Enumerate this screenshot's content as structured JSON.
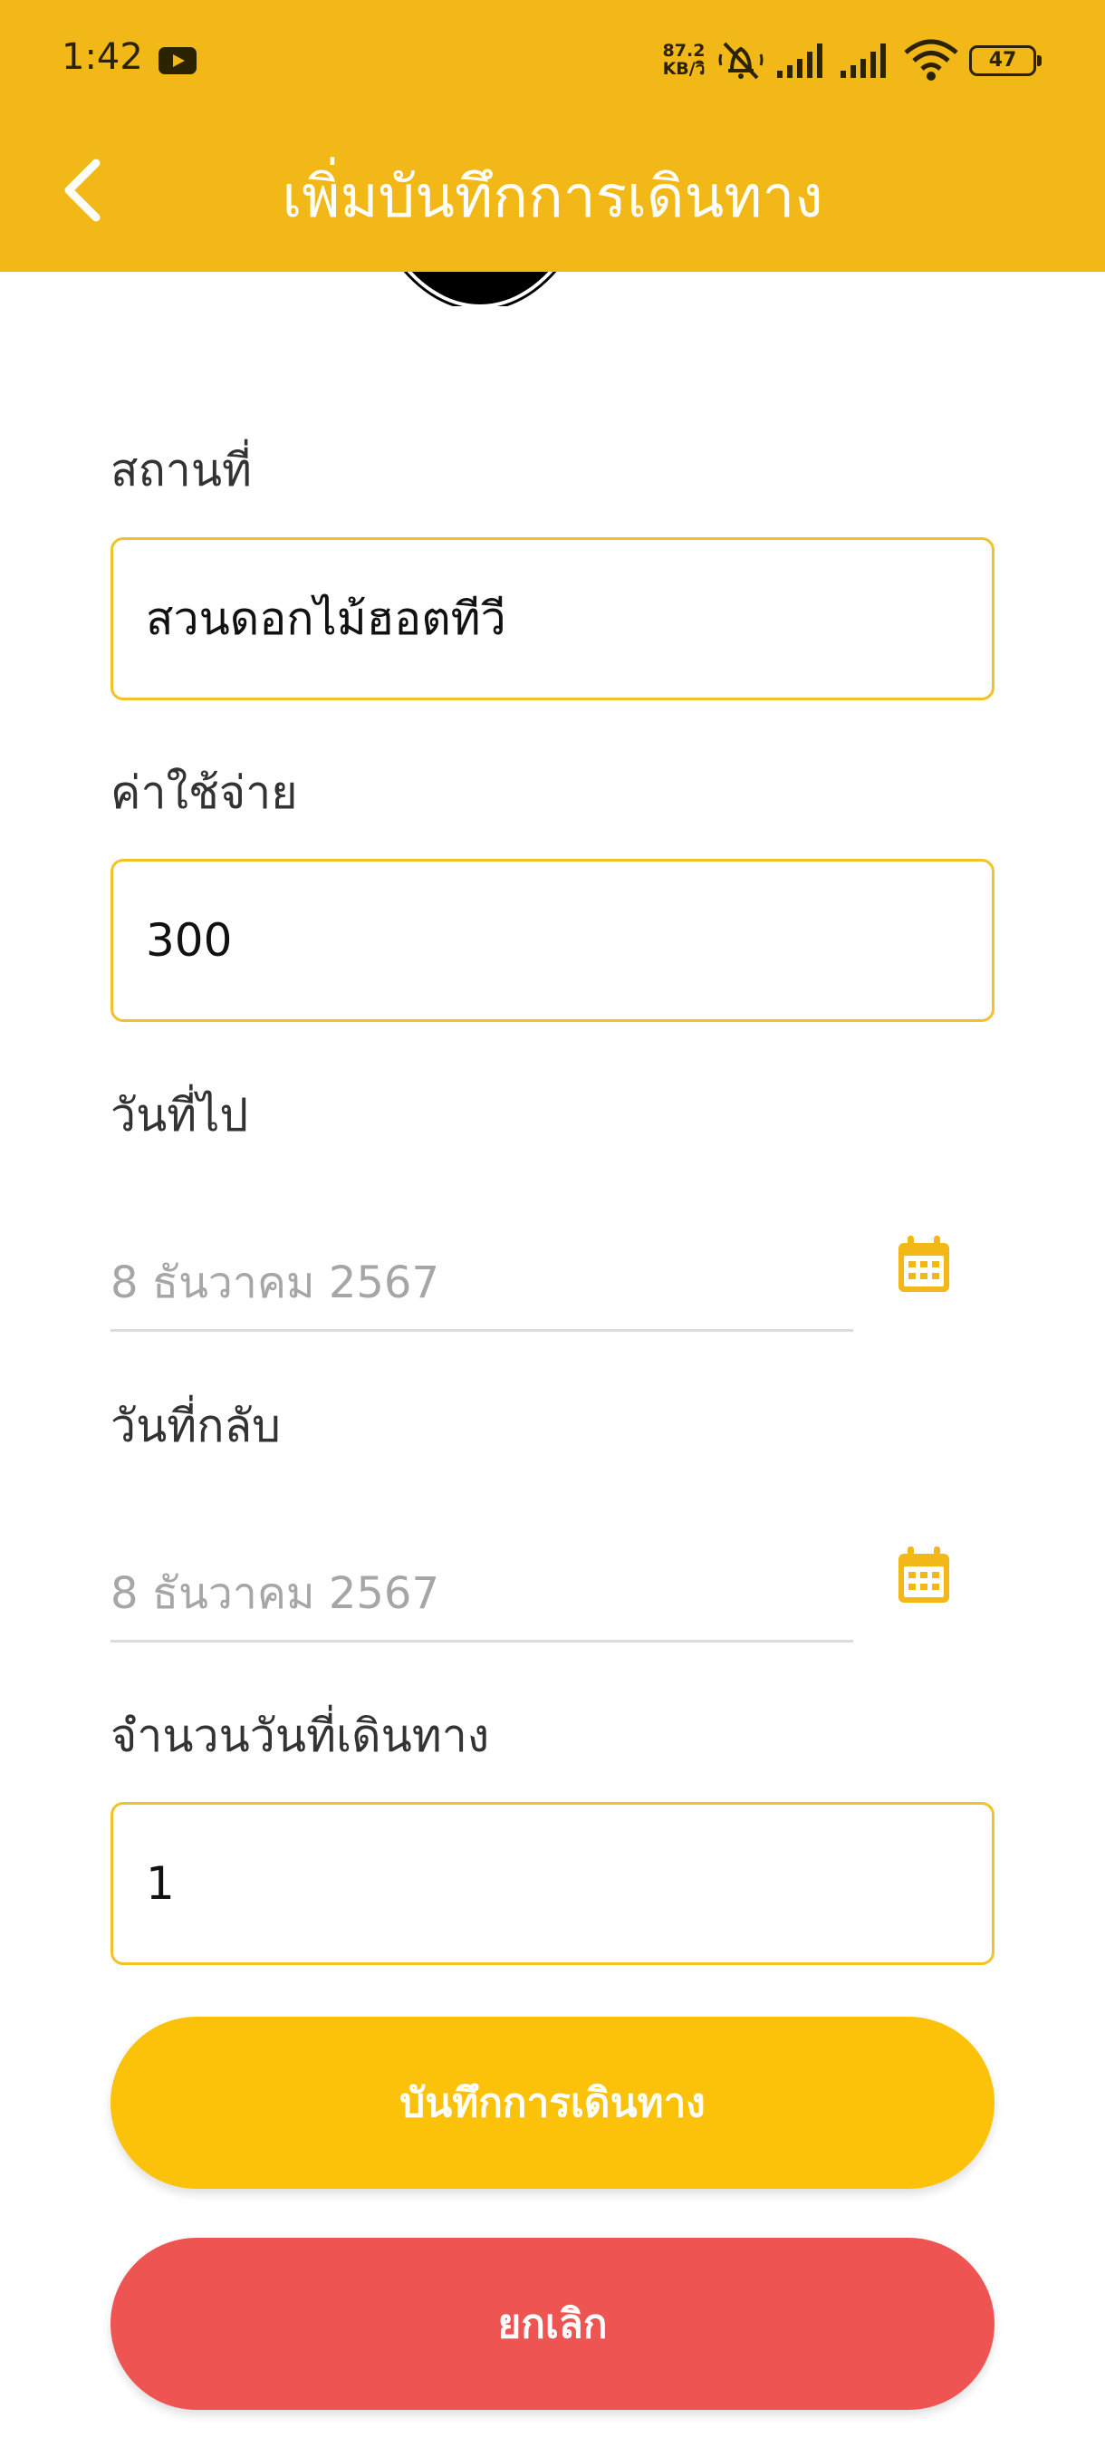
{
  "status_bar": {
    "time": "1:42",
    "net_speed_value": "87.2",
    "net_speed_unit": "KB/วิ",
    "battery": "47"
  },
  "header": {
    "title": "เพิ่มบันทึกการเดินทาง"
  },
  "form": {
    "place_label": "สถานที่",
    "place_value": "สวนดอกไม้ฮอตทีวี",
    "cost_label": "ค่าใช้จ่าย",
    "cost_value": "300",
    "depart_label": "วันที่ไป",
    "depart_value": "8 ธันวาคม 2567",
    "return_label": "วันที่กลับ",
    "return_value": "8 ธันวาคม 2567",
    "days_label": "จำนวนวันที่เดินทาง",
    "days_value": "1"
  },
  "buttons": {
    "save": "บันทึกการเดินทาง",
    "cancel": "ยกเลิก"
  },
  "colors": {
    "header": "#F2B817",
    "input_border": "#F3C22A",
    "save_button": "#FBC209",
    "cancel_button": "#EE5552",
    "calendar_icon": "#F2B817"
  },
  "icons": [
    "youtube-icon",
    "bell-muted-icon",
    "signal-icon",
    "wifi-icon",
    "battery-icon",
    "back-arrow-icon",
    "calendar-icon"
  ]
}
